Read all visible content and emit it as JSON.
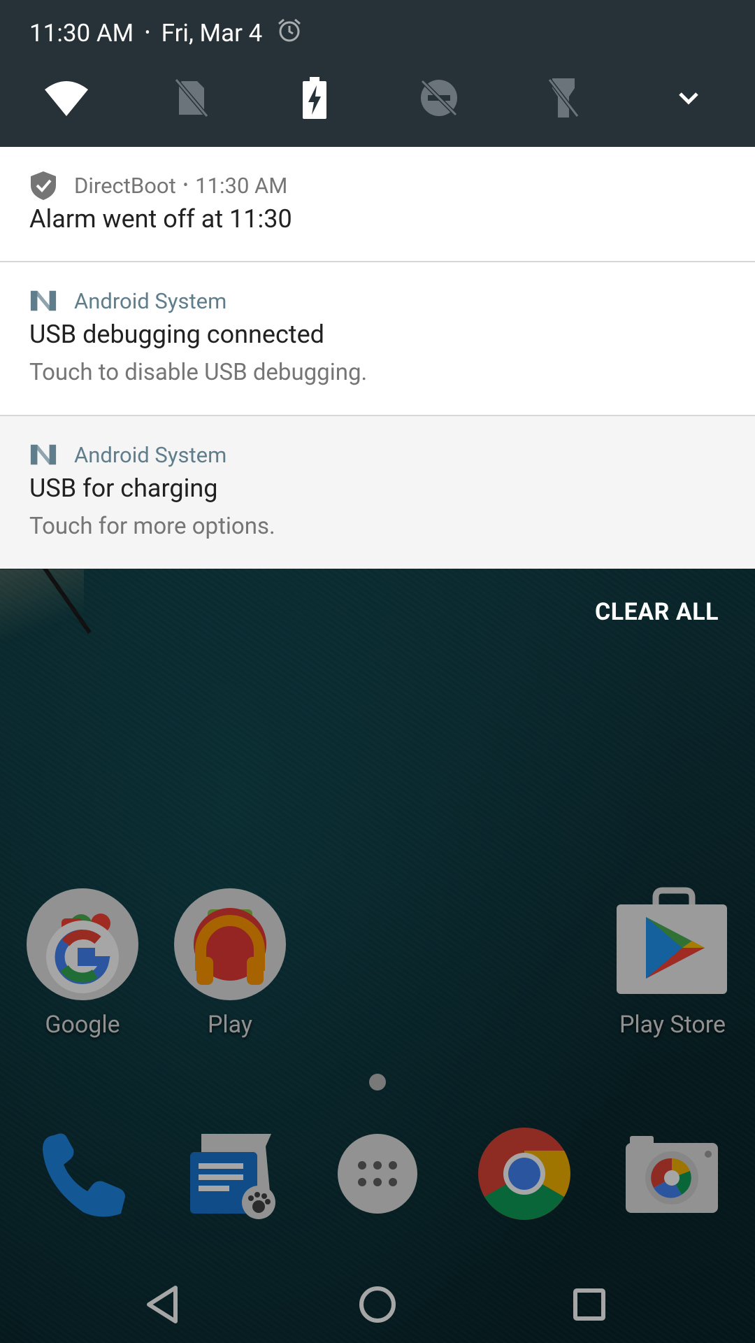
{
  "status_bar": {
    "time": "11:30 AM",
    "separator": "•",
    "date": "Fri, Mar 4"
  },
  "quick_settings": {
    "tiles": [
      "wifi-icon",
      "sim-off-icon",
      "battery-charging-icon",
      "dnd-off-icon",
      "flashlight-off-icon",
      "expand-chevron-icon"
    ]
  },
  "notifications": [
    {
      "app": "DirectBoot",
      "time": "11:30 AM",
      "title": "Alarm went off at 11:30"
    },
    {
      "app": "Android System",
      "title": "USB debugging connected",
      "text": "Touch to disable USB debugging."
    },
    {
      "app": "Android System",
      "title": "USB for charging",
      "text": "Touch for more options."
    }
  ],
  "clear_all": "CLEAR ALL",
  "home": {
    "apps": [
      {
        "label": "Google",
        "icon": "google-folder-icon"
      },
      {
        "label": "Play",
        "icon": "play-folder-icon"
      },
      {
        "label": "Play Store",
        "icon": "play-store-icon"
      }
    ],
    "dock": [
      "phone-icon",
      "messenger-icon",
      "app-drawer-icon",
      "chrome-icon",
      "camera-icon"
    ]
  },
  "navigation": [
    "back-button",
    "home-button",
    "recents-button"
  ],
  "colors": {
    "header_bg": "#263238",
    "system_app_name": "#607d8b"
  }
}
